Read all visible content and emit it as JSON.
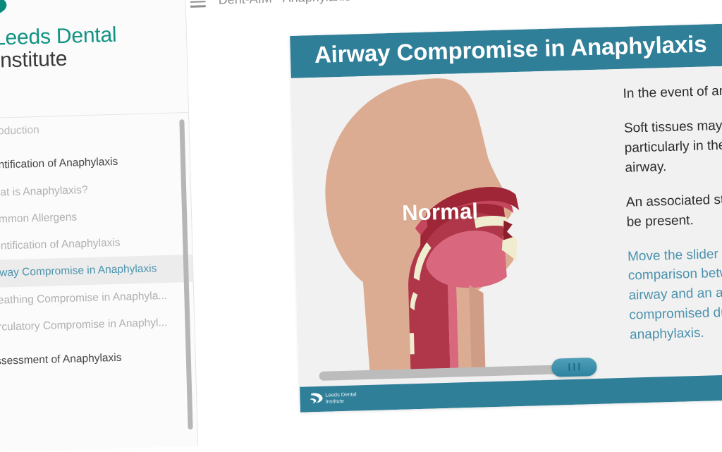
{
  "brand": {
    "logo_icon": "leeds-dental-swoosh-icon",
    "line1": "Leeds Dental",
    "line2": "Institute"
  },
  "topbar": {
    "menu_icon": "hamburger-menu-icon",
    "title": "Dent-AIM - Anaphylaxis"
  },
  "sidebar": {
    "items": [
      {
        "label": "Introduction",
        "type": "lead",
        "active": false
      },
      {
        "label": "Identification of Anaphylaxis",
        "type": "header",
        "active": false
      },
      {
        "label": "What is Anaphylaxis?",
        "type": "sub",
        "active": false
      },
      {
        "label": "Common Allergens",
        "type": "sub",
        "active": false
      },
      {
        "label": "Identification of Anaphylaxis",
        "type": "sub",
        "active": false
      },
      {
        "label": "Airway Compromise in Anaphylaxis",
        "type": "sub",
        "active": true
      },
      {
        "label": "Breathing Compromise in Anaphyla...",
        "type": "sub",
        "active": false
      },
      {
        "label": "Circulatory Compromise in Anaphyl...",
        "type": "sub",
        "active": false
      },
      {
        "label": "Assessment of Anaphylaxis",
        "type": "header",
        "active": false
      }
    ],
    "scrollbar": "vertical-scrollbar"
  },
  "slide": {
    "title": "Airway Compromise in Anaphylaxis",
    "illustration": {
      "label": "Normal",
      "alt_name": "sagittal-airway-anatomy-illustration"
    },
    "slider": {
      "name": "comparison-slider",
      "handle_icon": "slider-grip-icon",
      "value_percent": 87
    },
    "paragraphs": [
      "In the event of anaphylaxis...",
      "Soft tissues may swell,\nparticularly in the upper\nairway.",
      "An associated stridor may\nbe present."
    ],
    "hint": "Move the slider to see a\ncomparison between a normal\nairway and an airway\ncompromised due to\nanaphylaxis.",
    "footer": {
      "logo_icon": "leeds-dental-swoosh-icon",
      "line1": "Leeds Dental",
      "line2": "Institute"
    }
  },
  "colors": {
    "teal": "#2f7f99",
    "brand_green": "#0f9383",
    "hint_blue": "#4b92ad",
    "skin": "#dcac92",
    "tissue_dark": "#9e2636",
    "tissue_mid": "#c4475e",
    "tongue": "#d9687e",
    "teeth": "#efeccf"
  }
}
